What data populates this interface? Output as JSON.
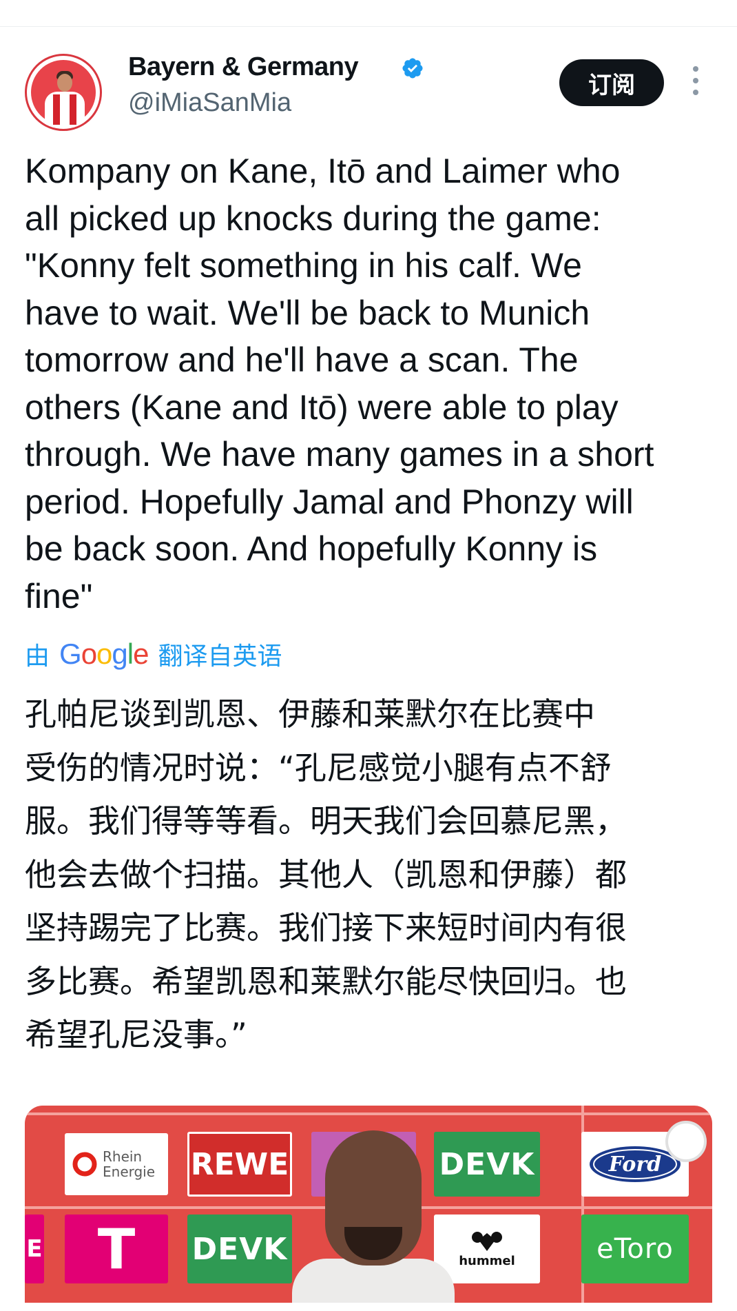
{
  "tweet": {
    "author": {
      "display_name": "Bayern & Germany",
      "handle": "@iMiaSanMia",
      "verified": true
    },
    "subscribe_label": "订阅",
    "text_lines": [
      "Kompany on Kane, Itō and Laimer who",
      "all picked up knocks during the game:",
      "\"Konny felt something in his calf. We",
      "have to wait. We'll be back to Munich",
      "tomorrow and he'll have a scan. The",
      "others (Kane and Itō) were able to play",
      "through. We have many games in a short",
      "period. Hopefully Jamal and Phonzy will",
      "be back soon. And hopefully Konny is",
      "fine\""
    ],
    "translation": {
      "prefix": "由",
      "provider": "Google",
      "suffix": "翻译自英语",
      "lines": [
        "孔帕尼谈到凯恩、伊藤和莱默尔在比赛中",
        "受伤的情况时说：“孔尼感觉小腿有点不舒",
        "服。我们得等等看。明天我们会回慕尼黑，",
        "他会去做个扫描。其他人（凯恩和伊藤）都",
        "坚持踢完了比赛。我们接下来短时间内有很",
        "多比赛。希望凯恩和莱默尔能尽快回归。也",
        "希望孔尼没事。”"
      ]
    },
    "media": {
      "sponsors": {
        "rhein": "Rhein Energie",
        "rewe": "REWE",
        "devk": "DEVK",
        "ford": "Ford",
        "telekom": "T",
        "hummel": "hummel",
        "etoro": "eToro",
        "partial_e": "E"
      }
    }
  },
  "colors": {
    "accent_blue": "#1d9bf0",
    "text": "#0f1419",
    "muted": "#536471",
    "subscribe_bg": "#0f1419"
  }
}
